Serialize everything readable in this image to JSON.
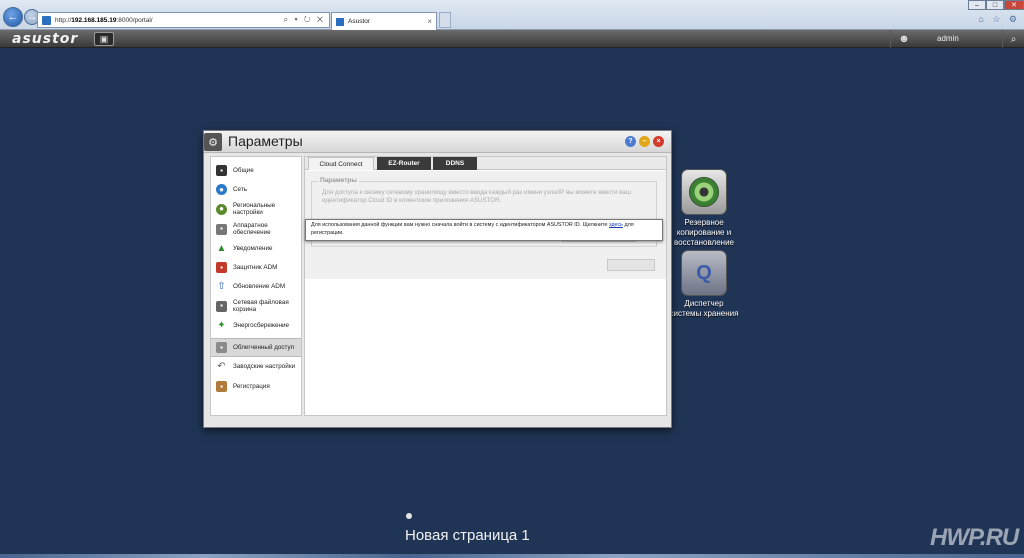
{
  "browser": {
    "url_prefix": "http://",
    "url_host": "192.168.185.19",
    "url_rest": ":8000/portal/",
    "address_tools": "⌕ ▾ ↻ ✕",
    "tab_title": "Asustor",
    "tab_close": "×",
    "back_glyph": "←",
    "fwd_glyph": "→",
    "win_min": "–",
    "win_max": "□",
    "win_close": "✕",
    "right_icons": "⌂ ☆ ⚙"
  },
  "adm": {
    "logo": "asustor",
    "home_glyph": "▣",
    "user_glyph": "☻",
    "username": "admin",
    "search_glyph": "⌕"
  },
  "desktop": {
    "icons": [
      {
        "label": "Резервное копирование и восстановление"
      },
      {
        "label": "Диспетчер системы хранения"
      }
    ],
    "storage_glyph": "Q",
    "page_label": "Новая страница 1",
    "watermark": "HWP.RU"
  },
  "window": {
    "app_glyph": "⚙",
    "title": "Параметры",
    "help_glyph": "?",
    "min_glyph": "–",
    "close_glyph": "×",
    "sidebar": {
      "items": [
        {
          "label": "Общие",
          "glyph": "▪"
        },
        {
          "label": "Сеть",
          "glyph": "●"
        },
        {
          "label": "Региональные настройки",
          "glyph": "●"
        },
        {
          "label": "Аппаратное обеспечение",
          "glyph": "▪"
        },
        {
          "label": "Уведомление",
          "glyph": "▲"
        },
        {
          "label": "Защитник ADM",
          "glyph": "▪"
        },
        {
          "label": "Обновление ADM",
          "glyph": "⇧"
        },
        {
          "label": "Сетевая файловая корзина",
          "glyph": "▪"
        },
        {
          "label": "Энергосбережение",
          "glyph": "✦"
        },
        {
          "label": "Облегченный доступ",
          "glyph": "▪"
        },
        {
          "label": "Заводские настройки",
          "glyph": "↶"
        },
        {
          "label": "Регистрация",
          "glyph": "▪"
        }
      ],
      "selected_index": 9
    },
    "tabs": [
      {
        "label": "Cloud Connect"
      },
      {
        "label": "EZ-Router"
      },
      {
        "label": "DDNS"
      }
    ],
    "fieldset": {
      "legend": "Параметры",
      "text": "Для доступа к своему сетевому хранилищу вместо ввода каждый раз имени узла/IP вы можете ввести ваш идентификатор Cloud ID в клиентские приложения ASUSTOR."
    },
    "tooltip": {
      "text": "Для использования данной функции вам нужно сначала войти в систему с идентификатором ASUSTOR ID. Щелкните ",
      "link": "здесь",
      "after": " для регистрации."
    }
  }
}
